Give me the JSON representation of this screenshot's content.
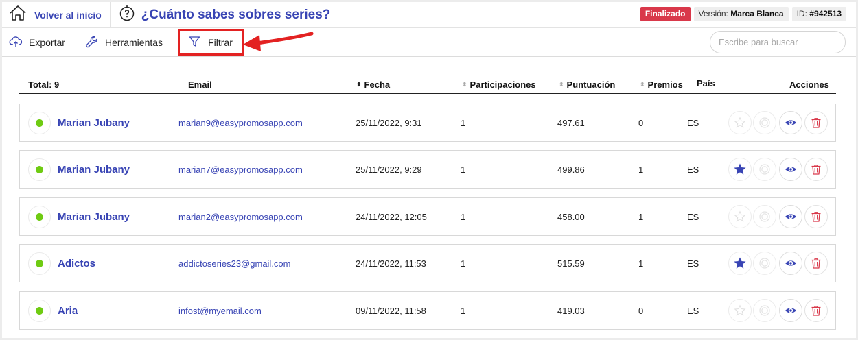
{
  "header": {
    "home_label": "Volver al inicio",
    "title": "¿Cuánto sabes sobres series?",
    "status": "Finalizado",
    "version_label": "Versión:",
    "version_value": "Marca Blanca",
    "id_label": "ID:",
    "id_value": "#942513"
  },
  "toolbar": {
    "export_label": "Exportar",
    "tools_label": "Herramientas",
    "filter_label": "Filtrar",
    "search_placeholder": "Escribe para buscar"
  },
  "table": {
    "total_label": "Total: 9",
    "columns": {
      "email": "Email",
      "date": "Fecha",
      "participations": "Participaciones",
      "score": "Puntuación",
      "prizes": "Premios",
      "country": "País",
      "actions": "Acciones"
    },
    "rows": [
      {
        "name": "Marian Jubany",
        "email": "marian9@easypromosapp.com",
        "date": "25/11/2022, 9:31",
        "participations": "1",
        "score": "497.61",
        "prizes": "0",
        "country": "ES",
        "starred": false
      },
      {
        "name": "Marian Jubany",
        "email": "marian7@easypromosapp.com",
        "date": "25/11/2022, 9:29",
        "participations": "1",
        "score": "499.86",
        "prizes": "1",
        "country": "ES",
        "starred": true
      },
      {
        "name": "Marian Jubany",
        "email": "marian2@easypromosapp.com",
        "date": "24/11/2022, 12:05",
        "participations": "1",
        "score": "458.00",
        "prizes": "1",
        "country": "ES",
        "starred": false
      },
      {
        "name": "Adictos",
        "email": "addictoseries23@gmail.com",
        "date": "24/11/2022, 11:53",
        "participations": "1",
        "score": "515.59",
        "prizes": "1",
        "country": "ES",
        "starred": true
      },
      {
        "name": "Aria",
        "email": "infost@myemail.com",
        "date": "09/11/2022, 11:58",
        "participations": "1",
        "score": "419.03",
        "prizes": "0",
        "country": "ES",
        "starred": false
      }
    ]
  },
  "colors": {
    "accent": "#3844b4",
    "status": "#d9384a",
    "online_dot": "#6fcb12",
    "delete": "#d9384a",
    "highlight": "#e32222"
  }
}
